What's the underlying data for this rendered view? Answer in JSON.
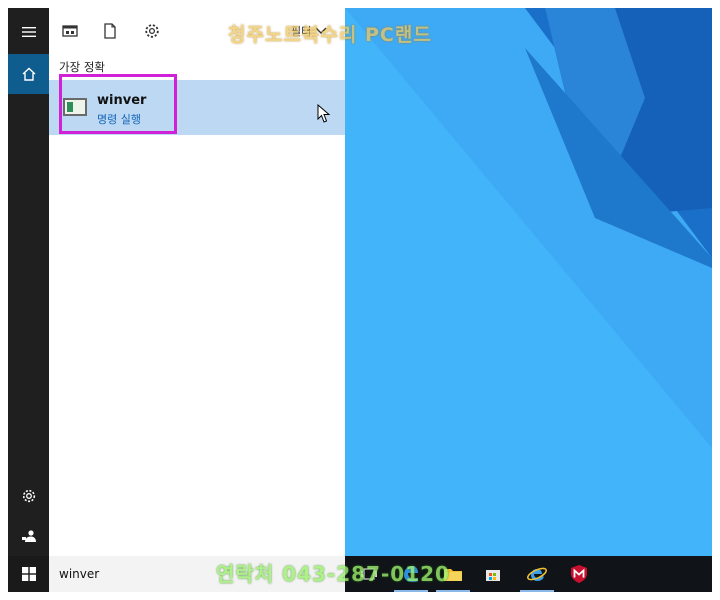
{
  "start_panel": {
    "section_label": "가장 정확",
    "filter_label": "필터",
    "result": {
      "name": "winver",
      "subtitle": "명령 실행"
    }
  },
  "taskbar": {
    "search_text": "winver"
  },
  "watermark": {
    "top": "청주노트북수리 PC랜드",
    "bottom": "연락처 043-287-0120"
  },
  "icons": {
    "rail": [
      "hamburger-menu-icon",
      "home-icon",
      "settings-gear-icon",
      "user-account-icon"
    ],
    "topbar": [
      "apps-icon",
      "documents-icon",
      "settings-icon",
      "chevron-down-icon"
    ],
    "taskbar": [
      "windows-logo-icon",
      "task-view-icon",
      "edge-icon",
      "file-explorer-icon",
      "store-icon",
      "internet-explorer-icon",
      "mcafee-icon"
    ]
  },
  "colors": {
    "rail": "#1f1f1f",
    "rail_active": "#0f5c8f",
    "result_highlight": "#bcd8f2",
    "annotation_box": "#d020d8",
    "desktop_blue": "#3aa4f2",
    "taskbar": "#101418"
  }
}
